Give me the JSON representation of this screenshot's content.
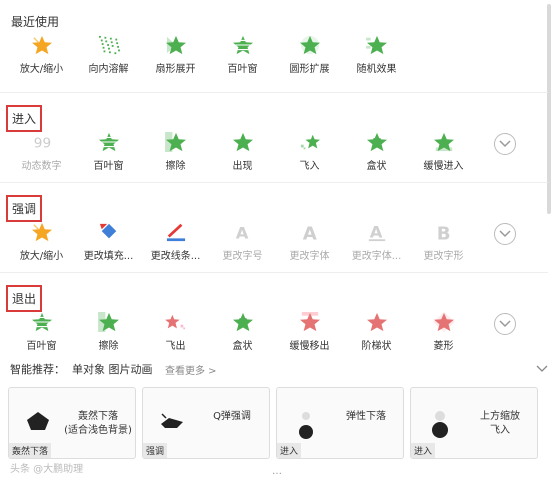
{
  "recent": {
    "title": "最近使用",
    "items": [
      {
        "label": "放大/缩小",
        "icon": "star-zoom-icon"
      },
      {
        "label": "向内溶解",
        "icon": "dissolve-icon"
      },
      {
        "label": "扇形展开",
        "icon": "wheel-icon"
      },
      {
        "label": "百叶窗",
        "icon": "blinds-icon"
      },
      {
        "label": "圆形扩展",
        "icon": "circle-expand-icon"
      },
      {
        "label": "随机效果",
        "icon": "random-icon"
      }
    ]
  },
  "enter": {
    "title": "进入",
    "items": [
      {
        "label": "动态数字",
        "icon": "dynamic-number-icon",
        "muted": true
      },
      {
        "label": "百叶窗",
        "icon": "blinds-icon"
      },
      {
        "label": "擦除",
        "icon": "wipe-icon"
      },
      {
        "label": "出现",
        "icon": "appear-icon"
      },
      {
        "label": "飞入",
        "icon": "fly-in-icon"
      },
      {
        "label": "盒状",
        "icon": "box-icon"
      },
      {
        "label": "缓慢进入",
        "icon": "crawl-in-icon"
      }
    ]
  },
  "emphasis": {
    "title": "强调",
    "items": [
      {
        "label": "放大/缩小",
        "icon": "star-zoom-icon"
      },
      {
        "label": "更改填充...",
        "icon": "fill-color-icon"
      },
      {
        "label": "更改线条...",
        "icon": "line-color-icon"
      },
      {
        "label": "更改字号",
        "icon": "font-size-icon",
        "muted": true
      },
      {
        "label": "更改字体",
        "icon": "font-icon",
        "muted": true
      },
      {
        "label": "更改字体...",
        "icon": "font-color-icon",
        "muted": true
      },
      {
        "label": "更改字形",
        "icon": "font-style-icon",
        "muted": true
      }
    ]
  },
  "exit": {
    "title": "退出",
    "items": [
      {
        "label": "百叶窗",
        "icon": "blinds-icon"
      },
      {
        "label": "擦除",
        "icon": "wipe-icon"
      },
      {
        "label": "飞出",
        "icon": "fly-out-icon"
      },
      {
        "label": "盒状",
        "icon": "box-icon"
      },
      {
        "label": "缓慢移出",
        "icon": "crawl-out-icon"
      },
      {
        "label": "阶梯状",
        "icon": "stairs-icon"
      },
      {
        "label": "菱形",
        "icon": "diamond-icon"
      }
    ]
  },
  "recommend": {
    "title": "智能推荐：",
    "subtitle": "单对象 图片动画",
    "more": "查看更多 >",
    "cards": [
      {
        "text": "轰然下落\n(适合浅色背景)",
        "tag": "轰然下落"
      },
      {
        "text": "Q弹强调",
        "tag": "强调"
      },
      {
        "text": "弹性下落",
        "tag": "进入"
      },
      {
        "text": "上方缩放\n飞入",
        "tag": "进入"
      }
    ]
  },
  "watermark": "头条 @大鹏助理",
  "colors": {
    "enter": "#4caf50",
    "emphasis": "#f5a623",
    "exit": "#e57373",
    "highlight": "#d93a3a"
  }
}
